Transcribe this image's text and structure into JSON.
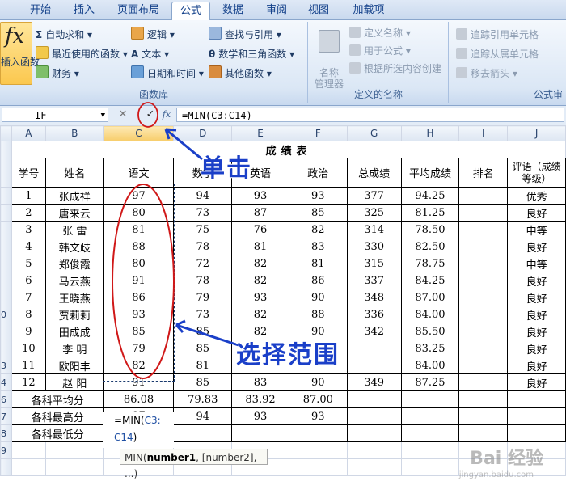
{
  "ribbon": {
    "tabs": [
      "开始",
      "插入",
      "页面布局",
      "公式",
      "数据",
      "审阅",
      "视图",
      "加载项"
    ],
    "active_tab": "公式",
    "library": {
      "insert_function": "插入函数",
      "autosum": "自动求和",
      "recent": "最近使用的函数",
      "financial": "财务",
      "logical": "逻辑",
      "text": "文本",
      "datetime": "日期和时间",
      "lookup": "查找与引用",
      "math": "数学和三角函数",
      "more": "其他函数",
      "label": "函数库"
    },
    "names": {
      "manager": "名称\n管理器",
      "define": "定义名称",
      "use_in_formula": "用于公式",
      "create_from_selection": "根据所选内容创建",
      "label": "定义的名称"
    },
    "auditing": {
      "trace_precedents": "追踪引用单元格",
      "trace_dependents": "追踪从属单元格",
      "remove_arrows": "移去箭头",
      "label": "公式审"
    }
  },
  "formula_bar": {
    "name_box": "IF",
    "formula": "=MIN(C3:C14)"
  },
  "columns": [
    "A",
    "B",
    "C",
    "D",
    "E",
    "F",
    "G",
    "H",
    "I",
    "J"
  ],
  "row_numbers": [
    "",
    "",
    "",
    "",
    "",
    "",
    "",
    "",
    "",
    "0",
    "",
    "",
    "3",
    "4",
    "5",
    "6",
    "7",
    "8",
    "9"
  ],
  "sheet": {
    "title": "成绩表",
    "headers": [
      "学号",
      "姓名",
      "语文",
      "数学",
      "英语",
      "政治",
      "总成绩",
      "平均成绩",
      "排名",
      "评语（成绩等级）"
    ],
    "rows": [
      [
        "1",
        "张成祥",
        "97",
        "94",
        "93",
        "93",
        "377",
        "94.25",
        "",
        "优秀"
      ],
      [
        "2",
        "唐来云",
        "80",
        "73",
        "87",
        "85",
        "325",
        "81.25",
        "",
        "良好"
      ],
      [
        "3",
        "张 雷",
        "81",
        "75",
        "76",
        "82",
        "314",
        "78.50",
        "",
        "中等"
      ],
      [
        "4",
        "韩文歧",
        "88",
        "78",
        "81",
        "83",
        "330",
        "82.50",
        "",
        "良好"
      ],
      [
        "5",
        "郑俊霞",
        "80",
        "72",
        "82",
        "81",
        "315",
        "78.75",
        "",
        "中等"
      ],
      [
        "6",
        "马云燕",
        "91",
        "78",
        "82",
        "86",
        "337",
        "84.25",
        "",
        "良好"
      ],
      [
        "7",
        "王晓燕",
        "86",
        "79",
        "93",
        "90",
        "348",
        "87.00",
        "",
        "良好"
      ],
      [
        "8",
        "贾莉莉",
        "93",
        "73",
        "82",
        "88",
        "336",
        "84.00",
        "",
        "良好"
      ],
      [
        "9",
        "田成成",
        "85",
        "85",
        "82",
        "90",
        "342",
        "85.50",
        "",
        "良好"
      ],
      [
        "10",
        "李 明",
        "79",
        "85",
        "",
        "",
        "",
        "83.25",
        "",
        "良好"
      ],
      [
        "11",
        "欧阳丰",
        "82",
        "81",
        "",
        "",
        "",
        "84.00",
        "",
        "良好"
      ],
      [
        "12",
        "赵 阳",
        "91",
        "85",
        "83",
        "90",
        "349",
        "87.25",
        "",
        "良好"
      ]
    ],
    "avg_label": "各科平均分",
    "avg": [
      "86.08",
      "79.83",
      "83.92",
      "87.00"
    ],
    "max_label": "各科最高分",
    "max": [
      "97",
      "94",
      "93",
      "93"
    ],
    "min_label": "各科最低分"
  },
  "editing": {
    "prefix": "=MIN(",
    "ref1": "C3:",
    "ref2": "C14",
    "suffix": ")",
    "tooltip_fn": "MIN(",
    "tooltip_arg1": "number1",
    "tooltip_rest": ", [number2], ...)"
  },
  "annotations": {
    "click": "单击",
    "select_range": "选择范围",
    "color": "#1a3fc8"
  },
  "watermark": "Bai 经验",
  "watermark_url": "jingyan.baidu.com"
}
